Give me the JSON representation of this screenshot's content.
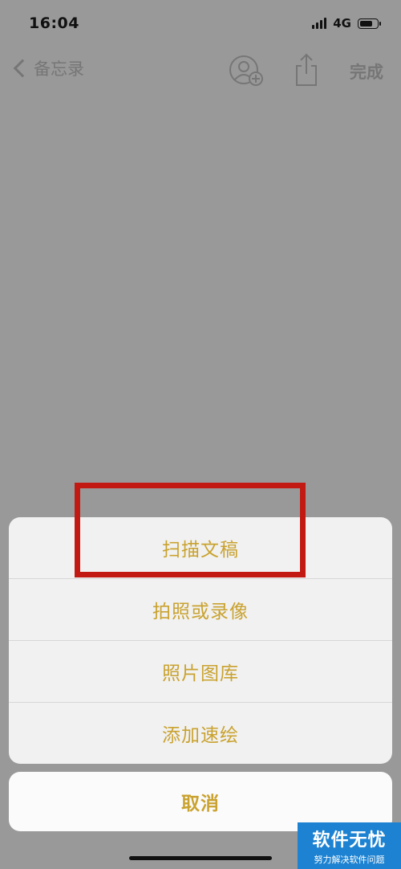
{
  "status_bar": {
    "time": "16:04",
    "network": "4G",
    "battery_level": 0.8
  },
  "nav": {
    "back_label": "备忘录",
    "done_label": "完成"
  },
  "action_sheet": {
    "items": [
      {
        "label": "扫描文稿"
      },
      {
        "label": "拍照或录像"
      },
      {
        "label": "照片图库"
      },
      {
        "label": "添加速绘"
      }
    ],
    "cancel_label": "取消"
  },
  "colors": {
    "accent": "#c9a22f",
    "highlight": "#c21a12",
    "watermark_bg": "#1c82d1"
  },
  "watermark": {
    "title": "软件无忧",
    "subtitle": "努力解决软件问题"
  }
}
